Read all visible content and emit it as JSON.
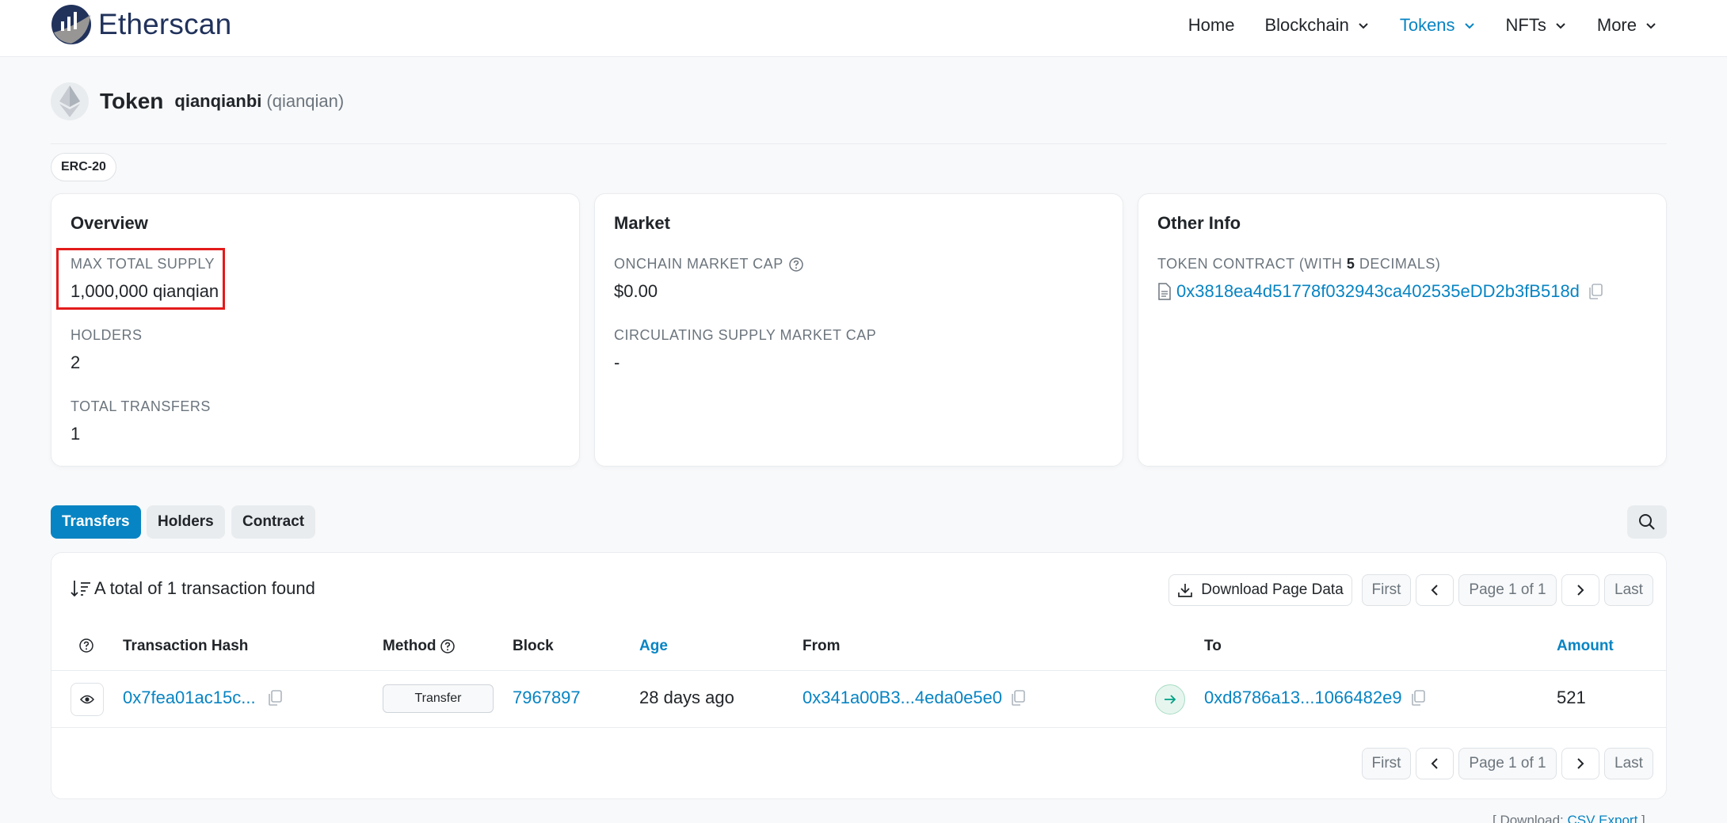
{
  "brand": {
    "name": "Etherscan"
  },
  "nav": {
    "home": "Home",
    "blockchain": "Blockchain",
    "tokens": "Tokens",
    "nfts": "NFTs",
    "more": "More"
  },
  "token": {
    "title": "Token",
    "name": "qianqianbi",
    "symbol": "(qianqian)",
    "standard": "ERC-20"
  },
  "overview": {
    "title": "Overview",
    "max_supply_label": "MAX TOTAL SUPPLY",
    "max_supply_value": "1,000,000 qianqian",
    "holders_label": "HOLDERS",
    "holders_value": "2",
    "transfers_label": "TOTAL TRANSFERS",
    "transfers_value": "1"
  },
  "market": {
    "title": "Market",
    "onchain_cap_label": "ONCHAIN MARKET CAP",
    "onchain_cap_value": "$0.00",
    "circ_cap_label": "CIRCULATING SUPPLY MARKET CAP",
    "circ_cap_value": "-"
  },
  "other": {
    "title": "Other Info",
    "contract_label_prefix": "TOKEN CONTRACT (WITH ",
    "contract_decimals": "5",
    "contract_label_suffix": " DECIMALS)",
    "contract_address": "0x3818ea4d51778f032943ca402535eDD2b3fB518d"
  },
  "tabs": {
    "transfers": "Transfers",
    "holders": "Holders",
    "contract": "Contract"
  },
  "table": {
    "summary": "A total of 1 transaction found",
    "download": "Download Page Data",
    "first": "First",
    "page": "Page 1 of 1",
    "last": "Last",
    "headers": {
      "hash": "Transaction Hash",
      "method": "Method",
      "block": "Block",
      "age": "Age",
      "from": "From",
      "to": "To",
      "amount": "Amount"
    },
    "row": {
      "hash": "0x7fea01ac15c...",
      "method": "Transfer",
      "block": "7967897",
      "age": "28 days ago",
      "from": "0x341a00B3...4eda0e5e0",
      "to": "0xd8786a13...1066482e9",
      "amount": "521"
    }
  },
  "footer": {
    "prefix": "[ Download: ",
    "link": "CSV Export",
    "suffix": " ]"
  },
  "colors": {
    "accent": "#0784c3",
    "highlight": "#e31b1b",
    "brand_dark": "#21325b"
  }
}
